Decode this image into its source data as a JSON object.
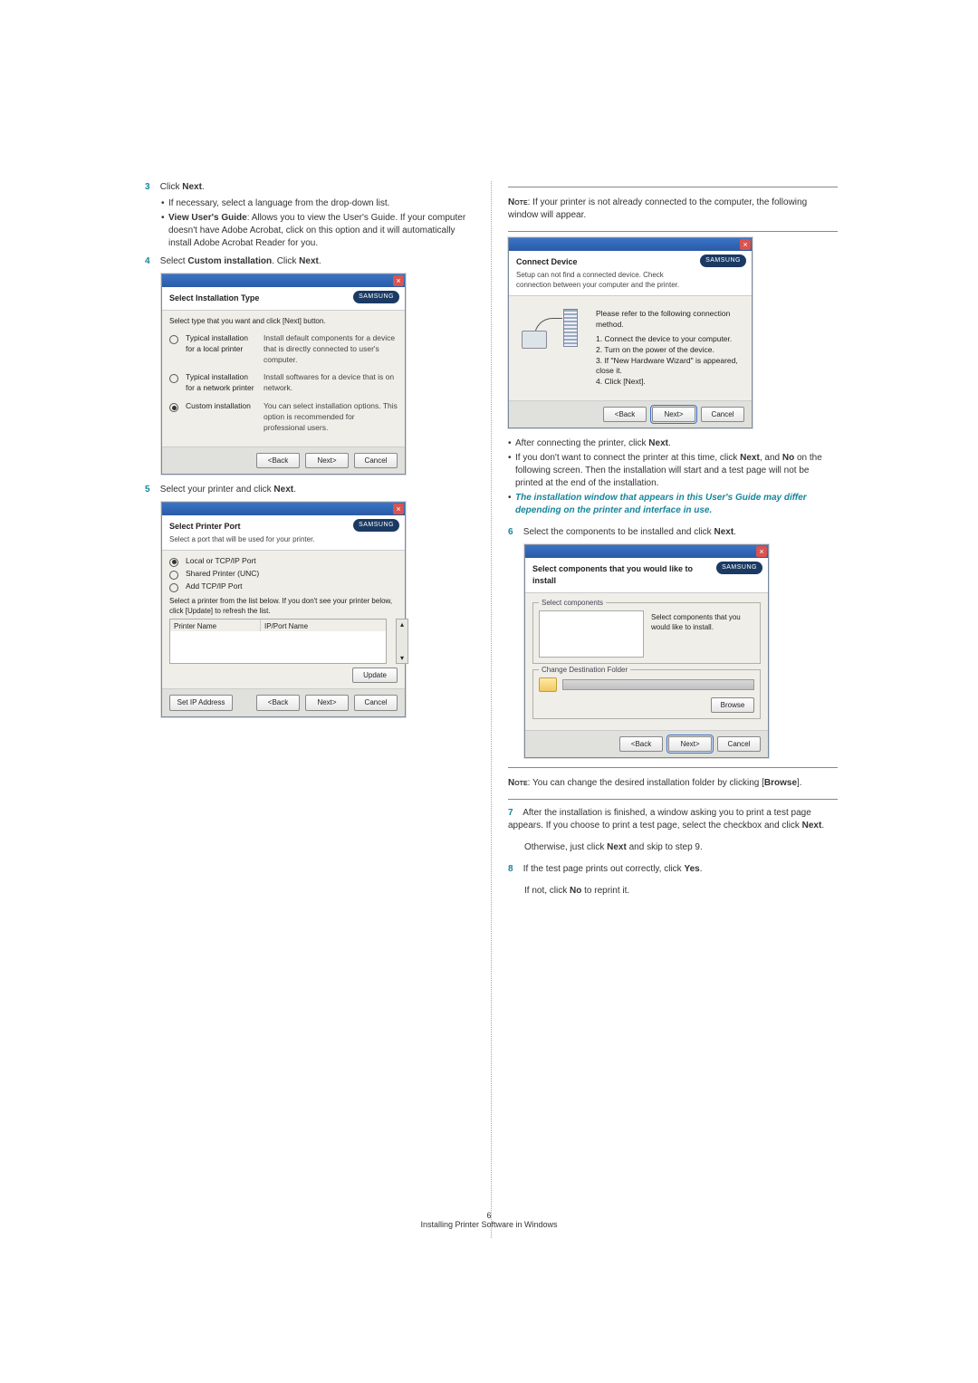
{
  "left_column": {
    "step3": {
      "num": "3",
      "text_prefix": "Click ",
      "text_bold": "Next",
      "text_suffix": ".",
      "bullets": [
        {
          "text": "If necessary, select a language from the drop-down list."
        },
        {
          "bold_lead": "View User's Guide",
          "text": ": Allows you to view the User's Guide. If your computer doesn't have Adobe Acrobat, click on this option and it will automatically install Adobe Acrobat Reader for you."
        }
      ]
    },
    "step4": {
      "num": "4",
      "text": "Select ",
      "bold1": "Custom installation",
      "mid": ". Click ",
      "bold2": "Next",
      "suffix": "."
    },
    "dialog1": {
      "title": "Select Installation Type",
      "subtitle": "Select type that you want and click [Next] button.",
      "logo": "SAMSUNG",
      "options": [
        {
          "label": "Typical installation for a local printer",
          "desc": "Install default components for a device that is directly connected to user's computer.",
          "checked": false
        },
        {
          "label": "Typical installation for a network printer",
          "desc": "Install softwares for a device that is on network.",
          "checked": false
        },
        {
          "label": "Custom installation",
          "desc": "You can select installation options. This option is recommended for professional users.",
          "checked": true
        }
      ],
      "buttons": {
        "back": "<Back",
        "next": "Next>",
        "cancel": "Cancel"
      }
    },
    "step5": {
      "num": "5",
      "text": "Select your printer and click ",
      "bold": "Next",
      "suffix": "."
    },
    "dialog2": {
      "title": "Select Printer Port",
      "subtitle": "Select a port that will be used for your printer.",
      "logo": "SAMSUNG",
      "radios": [
        {
          "label": "Local or TCP/IP Port",
          "checked": true
        },
        {
          "label": "Shared Printer (UNC)",
          "checked": false
        },
        {
          "label": "Add TCP/IP Port",
          "checked": false
        }
      ],
      "list_hint": "Select a printer from the list below. If you don't see your printer below, click [Update] to refresh the list.",
      "col1": "Printer Name",
      "col2": "IP/Port Name",
      "update_btn": "Update",
      "set_ip_btn": "Set IP Address",
      "buttons": {
        "back": "<Back",
        "next": "Next>",
        "cancel": "Cancel"
      }
    }
  },
  "right_column": {
    "note1": {
      "label": "Note",
      "text": ": If your printer is not already connected to the computer, the following window will appear."
    },
    "dialog3": {
      "title": "Connect Device",
      "subtitle": "Setup can not find a connected device. Check connection between your computer and the printer.",
      "logo": "SAMSUNG",
      "instr_lead": "Please refer to the following connection method.",
      "instr": [
        "1. Connect the device to your computer.",
        "2. Turn on the power of the device.",
        "3. If \"New Hardware Wizard\" is appeared, close it.",
        "4. Click [Next]."
      ],
      "buttons": {
        "back": "<Back",
        "next": "Next>",
        "cancel": "Cancel"
      }
    },
    "post_bullets": [
      {
        "plain_pre": "After connecting the printer, click ",
        "bold": "Next",
        "plain_post": "."
      },
      {
        "plain_pre": "If you don't want to connect the printer at this time, click ",
        "bold": "Next",
        "plain_mid": ", and ",
        "bold2": "No",
        "plain_post": " on the following screen. Then the installation will start and a test page will not be printed at the end of the installation."
      },
      {
        "ital": "The installation window that appears in this User's Guide may differ depending on the printer and interface in use."
      }
    ],
    "step6": {
      "num": "6",
      "text": "Select the components to be installed and click ",
      "bold": "Next",
      "suffix": "."
    },
    "dialog4": {
      "title": "Select components that you would like to install",
      "logo": "SAMSUNG",
      "group1": "Select components",
      "group1_right": "Select components that you would like to install.",
      "group2": "Change Destination Folder",
      "browse": "Browse",
      "buttons": {
        "back": "<Back",
        "next": "Next>",
        "cancel": "Cancel"
      }
    },
    "note2": {
      "label": "Note",
      "text": ": You can change the desired installation folder by clicking [",
      "bold": "Browse",
      "suffix": "]."
    },
    "step7": {
      "num": "7",
      "text": "After the installation is finished, a window asking you to print a test page appears. If you choose to print a test page, select the checkbox and click ",
      "bold": "Next",
      "suffix": ".",
      "line2_pre": "Otherwise, just click ",
      "line2_bold": "Next",
      "line2_post": " and skip to step 9."
    },
    "step8": {
      "num": "8",
      "text": "If the test page prints out correctly, click ",
      "bold": "Yes",
      "suffix": ".",
      "line2_pre": "If not, click ",
      "line2_bold": "No",
      "line2_post": " to reprint it."
    }
  },
  "footer": {
    "page_number": "6",
    "title": "Installing Printer Software in Windows"
  }
}
